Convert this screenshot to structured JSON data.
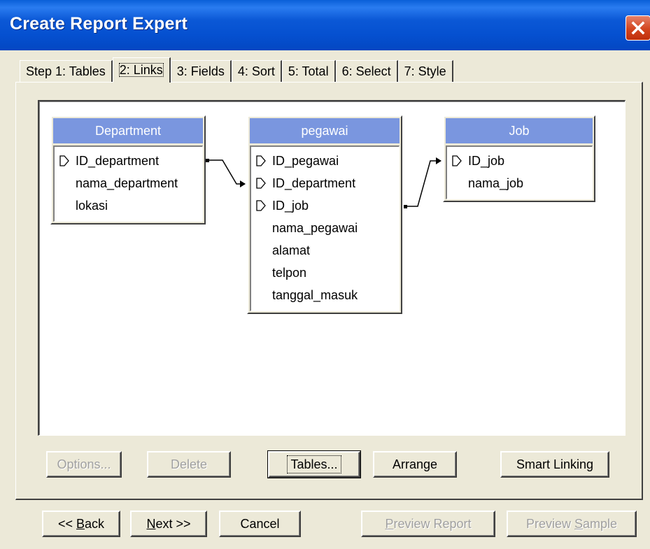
{
  "window": {
    "title": "Create Report Expert"
  },
  "tabs": [
    {
      "label": "Step 1: Tables"
    },
    {
      "label": "2: Links",
      "active": true
    },
    {
      "label": "3: Fields"
    },
    {
      "label": "4: Sort"
    },
    {
      "label": "5: Total"
    },
    {
      "label": "6: Select"
    },
    {
      "label": "7: Style"
    }
  ],
  "tables": {
    "department": {
      "title": "Department",
      "fields": [
        {
          "name": "ID_department",
          "key": true
        },
        {
          "name": "nama_department",
          "key": false
        },
        {
          "name": "lokasi",
          "key": false
        }
      ]
    },
    "pegawai": {
      "title": "pegawai",
      "fields": [
        {
          "name": "ID_pegawai",
          "key": true
        },
        {
          "name": "ID_department",
          "key": true
        },
        {
          "name": "ID_job",
          "key": true
        },
        {
          "name": "nama_pegawai",
          "key": false
        },
        {
          "name": "alamat",
          "key": false
        },
        {
          "name": "telpon",
          "key": false
        },
        {
          "name": "tanggal_masuk",
          "key": false
        }
      ]
    },
    "job": {
      "title": "Job",
      "fields": [
        {
          "name": "ID_job",
          "key": true
        },
        {
          "name": "nama_job",
          "key": false
        }
      ]
    }
  },
  "link_buttons": {
    "options": "Options...",
    "delete": "Delete",
    "tables": "Tables...",
    "arrange": "Arrange",
    "smart_linking": "Smart Linking"
  },
  "nav_buttons": {
    "back_prefix": "<< ",
    "back_key": "B",
    "back_rest": "ack",
    "next_key": "N",
    "next_rest": "ext >>",
    "cancel": "Cancel",
    "preview_report_key": "P",
    "preview_report_rest": "review Report",
    "preview_sample_prefix": "Preview ",
    "preview_sample_key": "S",
    "preview_sample_rest": "ample"
  },
  "colors": {
    "titlebar": "#0550d0",
    "table_header": "#7a96df",
    "face": "#ece9d8",
    "close": "#d3441e"
  }
}
